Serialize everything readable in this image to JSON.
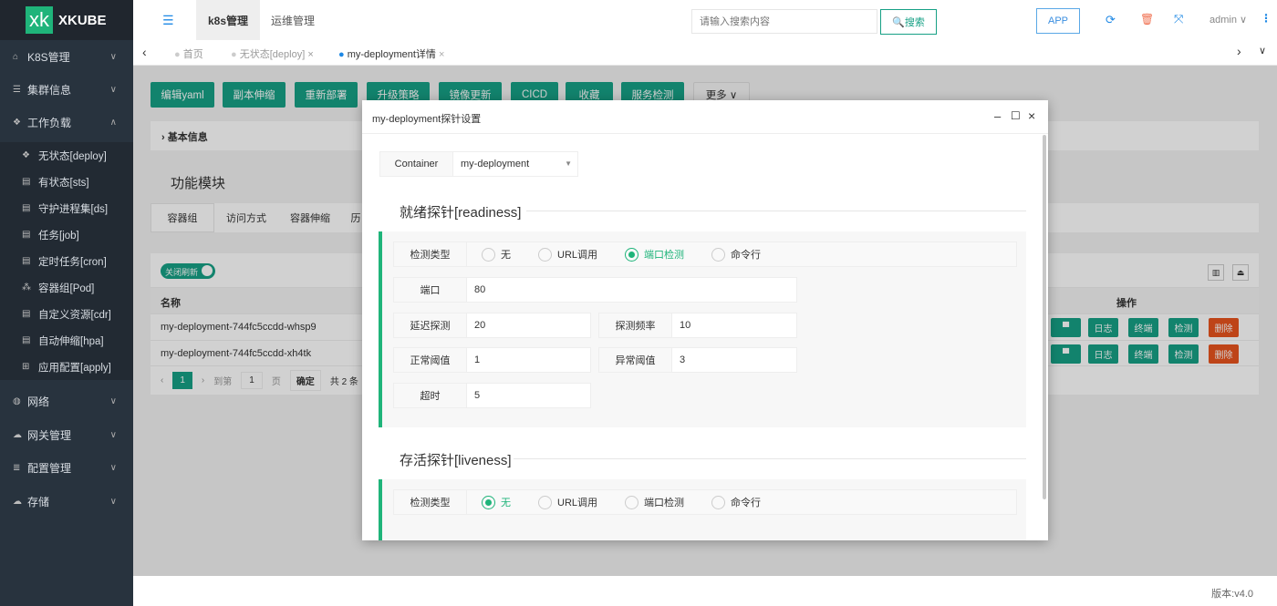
{
  "app": {
    "logo_mark": "xk",
    "logo_text": "XKUBE"
  },
  "sidebar": {
    "items": [
      {
        "label": "K8S管理",
        "icon": "home-icon"
      },
      {
        "label": "集群信息",
        "icon": "server-icon"
      },
      {
        "label": "工作负载",
        "icon": "cube-icon"
      },
      {
        "label": "网络",
        "icon": "globe-icon"
      },
      {
        "label": "网关管理",
        "icon": "cloud-icon"
      },
      {
        "label": "配置管理",
        "icon": "database-icon"
      },
      {
        "label": "存储",
        "icon": "cloud-icon"
      }
    ],
    "sub_items": [
      "无状态[deploy]",
      "有状态[sts]",
      "守护进程集[ds]",
      "任务[job]",
      "定时任务[cron]",
      "容器组[Pod]",
      "自定义资源[cdr]",
      "自动伸缩[hpa]",
      "应用配置[apply]"
    ]
  },
  "topbar": {
    "menus": [
      "k8s管理",
      "运维管理"
    ],
    "search_placeholder": "请输入搜索内容",
    "search_button": "🔍搜索",
    "app_button": "APP",
    "user": "admin"
  },
  "tabs": [
    "首页",
    "无状态[deploy]",
    "my-deployment详情"
  ],
  "toolbar": [
    "编辑yaml",
    "副本伸缩",
    "重新部署",
    "升级策略",
    "镜像更新",
    "CICD",
    "收藏",
    "服务检测"
  ],
  "toolbar_more": "更多",
  "basic_info": "基本信息",
  "module_title": "功能模块",
  "module_tabs": [
    "容器组",
    "访问方式",
    "容器伸缩",
    "历"
  ],
  "refresh_toggle": "关闭刷新",
  "table": {
    "col_name": "名称",
    "col_ops": "操作",
    "rows": [
      "my-deployment-744fc5ccdd-whsp9",
      "my-deployment-744fc5ccdd-xh4tk"
    ],
    "ops": [
      "▀",
      "日志",
      "终端",
      "检测",
      "删除"
    ]
  },
  "pagination": {
    "page": "1",
    "goto": "到第",
    "goto_value": "1",
    "page_unit": "页",
    "confirm": "确定",
    "total": "共 2 条"
  },
  "footer": {
    "version": "版本:v4.0"
  },
  "modal": {
    "title": "my-deployment探针设置",
    "container_label": "Container",
    "container_value": "my-deployment",
    "readiness": {
      "title": "就绪探针[readiness]",
      "type_label": "检测类型",
      "options": [
        "无",
        "URL调用",
        "端口检测",
        "命令行"
      ],
      "selected": "端口检测",
      "port_label": "端口",
      "port": "80",
      "delay_label": "延迟探测",
      "delay": "20",
      "period_label": "探测频率",
      "period": "10",
      "success_label": "正常阈值",
      "success": "1",
      "failure_label": "异常阈值",
      "failure": "3",
      "timeout_label": "超时",
      "timeout": "5"
    },
    "liveness": {
      "title": "存活探针[liveness]",
      "type_label": "检测类型",
      "options": [
        "无",
        "URL调用",
        "端口检测",
        "命令行"
      ],
      "selected": "无"
    }
  },
  "colors": {
    "accent": "#16a085",
    "danger": "#e8541e",
    "sidebar": "#28333e"
  }
}
